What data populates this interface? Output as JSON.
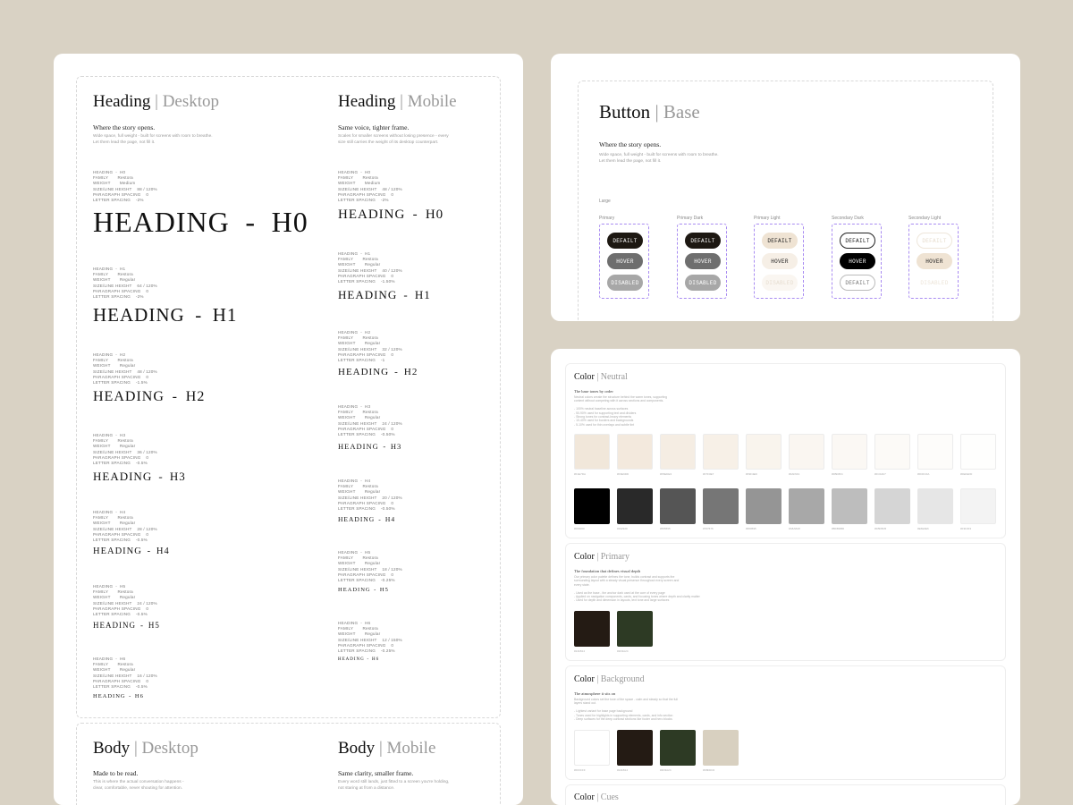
{
  "left_card": {
    "desktop_title": {
      "main": "Heading",
      "sep": "|",
      "sub": "Desktop"
    },
    "desktop_tagline": "Where the story opens.",
    "desktop_desc": "Wide space, full weight - built for screens with room to breathe.\nLet them lead the page, not fill it.",
    "mobile_title": {
      "main": "Heading",
      "sep": "|",
      "sub": "Mobile"
    },
    "mobile_tagline": "Same voice, tighter frame.",
    "mobile_desc": "Scales for smaller screens without losing presence - every\nsize still carries the weight of its desktop counterpart.",
    "desktop_headings": [
      {
        "label": "HEADING",
        "level": "H0",
        "specs": "HEADING  -  H0\nFAMILY       Restora\nWEIGHT       Medium\nSIZE/LINE HEIGHT    88 / 120%\nPARAGRAPH SPACING    0\nLETTER SPACING    -2%"
      },
      {
        "label": "HEADING",
        "level": "H1",
        "specs": "HEADING  -  H1\nFAMILY       Restora\nWEIGHT       Regular\nSIZE/LINE HEIGHT    64 / 120%\nPARAGRAPH SPACING    0\nLETTER SPACING    -2%"
      },
      {
        "label": "HEADING",
        "level": "H2",
        "specs": "HEADING  -  H2\nFAMILY       Restora\nWEIGHT       Regular\nSIZE/LINE HEIGHT    48 / 120%\nPARAGRAPH SPACING    0\nLETTER SPACING    -1.5%"
      },
      {
        "label": "HEADING",
        "level": "H3",
        "specs": "HEADING  -  H3\nFAMILY       Restora\nWEIGHT       Regular\nSIZE/LINE HEIGHT    36 / 120%\nPARAGRAPH SPACING    0\nLETTER SPACING    -0.5%"
      },
      {
        "label": "HEADING",
        "level": "H4",
        "specs": "HEADING  -  H4\nFAMILY       Restora\nWEIGHT       Regular\nSIZE/LINE HEIGHT    28 / 120%\nPARAGRAPH SPACING    0\nLETTER SPACING    -0.5%"
      },
      {
        "label": "HEADING",
        "level": "H5",
        "specs": "HEADING  -  H5\nFAMILY       Restora\nWEIGHT       Regular\nSIZE/LINE HEIGHT    24 / 120%\nPARAGRAPH SPACING    0\nLETTER SPACING    -0.5%"
      },
      {
        "label": "HEADING",
        "level": "H6",
        "specs": "HEADING  -  H6\nFAMILY       Restora\nWEIGHT       Regular\nSIZE/LINE HEIGHT    16 / 120%\nPARAGRAPH SPACING    0\nLETTER SPACING    -0.5%"
      }
    ],
    "mobile_headings": [
      {
        "label": "HEADING",
        "level": "H0",
        "specs": "HEADING  -  H0\nFAMILY       Restora\nWEIGHT       Medium\nSIZE/LINE HEIGHT    48 / 120%\nPARAGRAPH SPACING    0\nLETTER SPACING    -2%"
      },
      {
        "label": "HEADING",
        "level": "H1",
        "specs": "HEADING  -  H1\nFAMILY       Restora\nWEIGHT       Regular\nSIZE/LINE HEIGHT    40 / 120%\nPARAGRAPH SPACING    0\nLETTER SPACING    -1.50%"
      },
      {
        "label": "HEADING",
        "level": "H2",
        "specs": "HEADING  -  H2\nFAMILY       Restora\nWEIGHT       Regular\nSIZE/LINE HEIGHT    32 / 120%\nPARAGRAPH SPACING    0\nLETTER SPACING    -1"
      },
      {
        "label": "HEADING",
        "level": "H3",
        "specs": "HEADING  -  H3\nFAMILY       Restora\nWEIGHT       Regular\nSIZE/LINE HEIGHT    24 / 120%\nPARAGRAPH SPACING    0\nLETTER SPACING    -0.50%"
      },
      {
        "label": "HEADING",
        "level": "H4",
        "specs": "HEADING  -  H4\nFAMILY       Restora\nWEIGHT       Regular\nSIZE/LINE HEIGHT    20 / 120%\nPARAGRAPH SPACING    0\nLETTER SPACING    -0.50%"
      },
      {
        "label": "HEADING",
        "level": "H5",
        "specs": "HEADING  -  H5\nFAMILY       Restora\nWEIGHT       Regular\nSIZE/LINE HEIGHT    18 / 120%\nPARAGRAPH SPACING    0\nLETTER SPACING    -0.25%"
      },
      {
        "label": "HEADING",
        "level": "H6",
        "specs": "HEADING  -  H6\nFAMILY       Restora\nWEIGHT       Regular\nSIZE/LINE HEIGHT    12 / 150%\nPARAGRAPH SPACING    0\nLETTER SPACING    -0.25%"
      }
    ],
    "body_desktop_title": {
      "main": "Body",
      "sep": "|",
      "sub": "Desktop"
    },
    "body_desktop_tagline": "Made to be read.",
    "body_desktop_desc": "This is where the actual conversation happens -\nclear, comfortable, never shouting for attention.",
    "body_mobile_title": {
      "main": "Body",
      "sep": "|",
      "sub": "Mobile"
    },
    "body_mobile_tagline": "Same clarity, smaller frame.",
    "body_mobile_desc": "Every word still lands, just fitted to a screen you're holding,\nnot staring at from a distance."
  },
  "button_card": {
    "title": {
      "main": "Button",
      "sep": "|",
      "sub": "Base"
    },
    "tagline": "Where the story opens.",
    "desc": "Wide space, full weight - built for screens with room to breathe.\nLet them lead the page, not fill it.",
    "size_label": "Large",
    "groups": [
      {
        "name": "Primary",
        "buttons": [
          "DEFAILT",
          "HOVER",
          "DISABLED"
        ]
      },
      {
        "name": "Primary Dark",
        "buttons": [
          "DEFAILT",
          "HOVER",
          "DISABLED"
        ]
      },
      {
        "name": "Primary Light",
        "buttons": [
          "DEFAILT",
          "HOVER",
          "DISABLED"
        ]
      },
      {
        "name": "Secondary Dark",
        "buttons": [
          "DEFAILT",
          "HOVER",
          "DEFAILT"
        ]
      },
      {
        "name": "Secondary Light",
        "buttons": [
          "DEFAILT",
          "HOVER",
          "DISABLED"
        ]
      }
    ]
  },
  "color_card": {
    "neutral": {
      "title": {
        "main": "Color",
        "sep": "|",
        "sub": "Neutral"
      },
      "tagline": "The base tones by order",
      "notes": "Neutral colors create the structure behind the warm tones, supporting\ncontent without competing with it across sections and components.\n\n- 100% neutral baseline across surfaces\n- 50-90% used for supporting text and dividers\n- Strong tones for contrast-heavy elements\n- 10-40% used for borders and backgrounds\n- 5-10% used for thin overlays and subtle tint",
      "warm": [
        "#f1e7da",
        "#f3e9dd",
        "#f5ede3",
        "#f7f0e7",
        "#f9f4ed",
        "#faf6f1",
        "#fbf8f4",
        "#fcfaf7",
        "#fdfcfa",
        "#fefefd"
      ],
      "gray": [
        "#000000",
        "#292929",
        "#555555",
        "#767676",
        "#959595",
        "#a8a8a8",
        "#bdbdbd",
        "#d5d5d5",
        "#e6e6e6",
        "#f3f3f3"
      ]
    },
    "primary": {
      "title": {
        "main": "Color",
        "sep": "|",
        "sub": "Primary"
      },
      "tagline": "The foundation that defines visual depth",
      "notes": "Our primary color palette defines the tone, builds contrast and supports the\nsurrounding layout with a steady visual presence throughout every screen and\nevery state.\n\n- Used as the base - the anchor dark used at the core of every page\n- Applied on navigation components, cards, and focusing tones where depth and clarity matter\n- Used for depth and dimension in layouts, text tone and large surfaces",
      "swatches": [
        "#241b14",
        "#2d3a24"
      ]
    },
    "background": {
      "title": {
        "main": "Color",
        "sep": "|",
        "sub": "Background"
      },
      "tagline": "The atmosphere it sits on",
      "notes": "Background colors set the tone of the space - calm and steady so that the full\nlayers stand out.\n\n- Lightest variant for base page background\n- Tones used for highlights in supporting elements, cards, and info section\n- Deep surfaces for the deep contrast sections like footer and hero blocks",
      "swatches": [
        "#ffffff",
        "#241b14",
        "#2d3a24",
        "#d8d0c0"
      ]
    },
    "cues": {
      "title": {
        "main": "Color",
        "sep": "|",
        "sub": "Cues"
      }
    }
  }
}
